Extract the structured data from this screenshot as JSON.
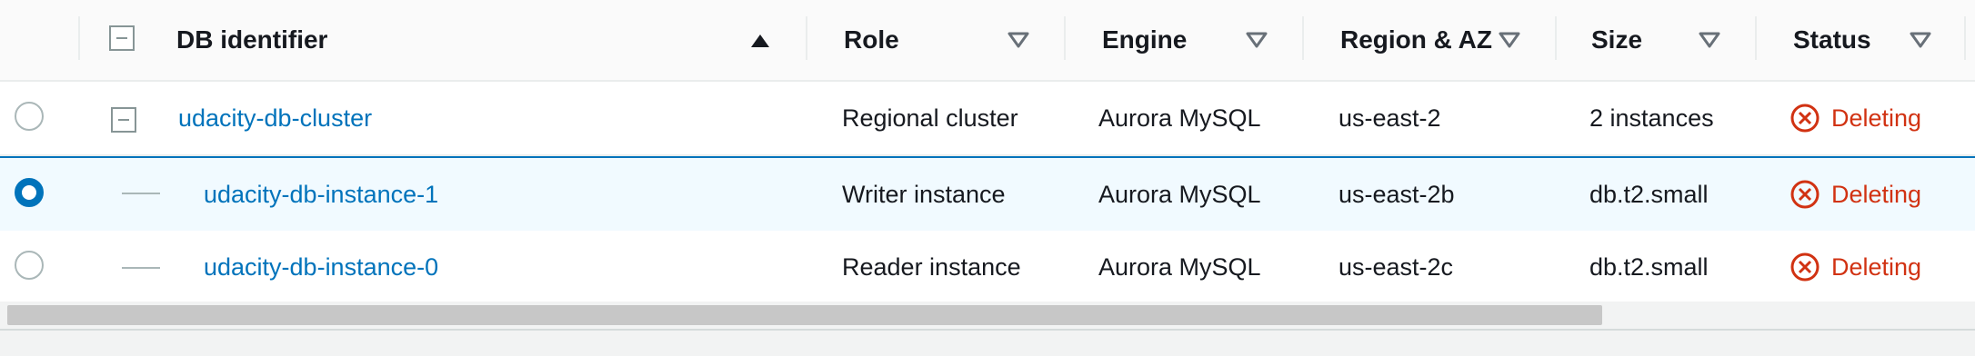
{
  "columns": {
    "db_identifier": "DB identifier",
    "role": "Role",
    "engine": "Engine",
    "region_az": "Region & AZ",
    "size": "Size",
    "status": "Status"
  },
  "rows": [
    {
      "identifier": "udacity-db-cluster",
      "role": "Regional cluster",
      "engine": "Aurora MySQL",
      "region": "us-east-2",
      "size": "2 instances",
      "status": "Deleting",
      "selected": false
    },
    {
      "identifier": "udacity-db-instance-1",
      "role": "Writer instance",
      "engine": "Aurora MySQL",
      "region": "us-east-2b",
      "size": "db.t2.small",
      "status": "Deleting",
      "selected": true
    },
    {
      "identifier": "udacity-db-instance-0",
      "role": "Reader instance",
      "engine": "Aurora MySQL",
      "region": "us-east-2c",
      "size": "db.t2.small",
      "status": "Deleting",
      "selected": false
    }
  ],
  "colors": {
    "link": "#0073bb",
    "status_deleting": "#d13212",
    "selected_bg": "#f1faff"
  },
  "icons": {
    "sort_asc": "triangle-up-icon",
    "sort_none": "triangle-down-outline-icon",
    "status": "x-circle-icon",
    "expand": "collapse-square-icon"
  }
}
